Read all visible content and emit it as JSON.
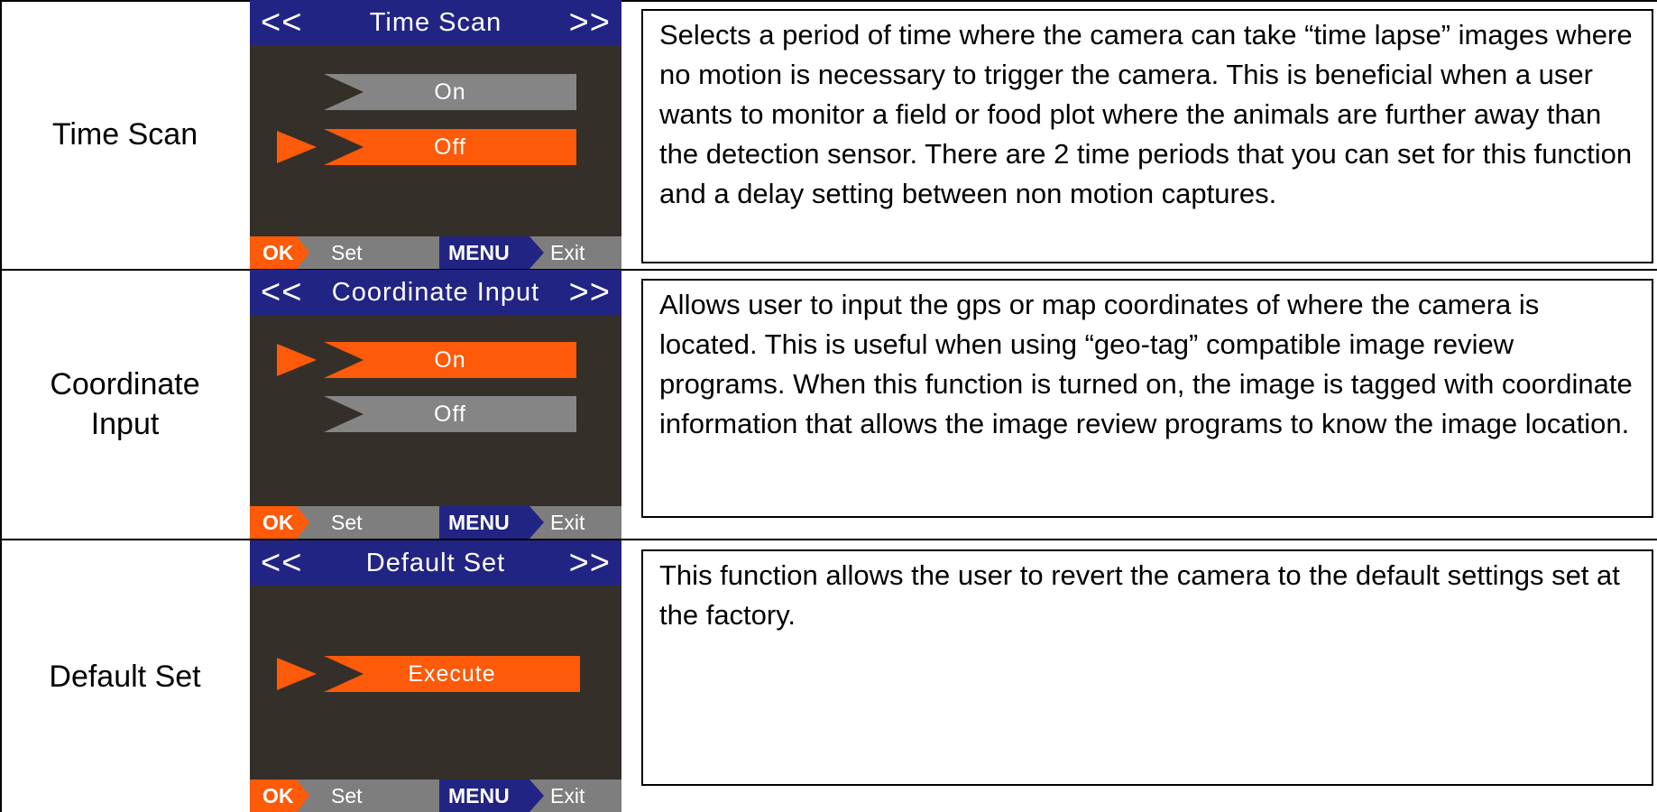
{
  "rows": [
    {
      "label": "Time Scan",
      "screen": {
        "title": "Time Scan",
        "nav_left": "<<",
        "nav_right": ">>",
        "options": [
          "On",
          "Off"
        ],
        "selected_index": 1,
        "footer": {
          "ok": "OK",
          "set": "Set",
          "menu": "MENU",
          "exit": "Exit"
        }
      },
      "description": "Selects a period of time where the camera can take “time lapse” images where no motion is necessary to trigger the camera.  This is beneficial when a user wants to monitor a field or food plot where the animals are further away than the detection sensor.  There are 2 time periods that you can set for this function and a delay setting between non motion captures."
    },
    {
      "label": "Coordinate Input",
      "screen": {
        "title": "Coordinate Input",
        "nav_left": "<<",
        "nav_right": ">>",
        "options": [
          "On",
          "Off"
        ],
        "selected_index": 0,
        "footer": {
          "ok": "OK",
          "set": "Set",
          "menu": "MENU",
          "exit": "Exit"
        }
      },
      "description": "Allows user to input the gps or map coordinates of where the camera is located.  This is useful when using “geo-tag” compatible image review programs.  When this function is turned on, the image is tagged with coordinate information that allows the image review programs to know the image location."
    },
    {
      "label": "Default Set",
      "screen": {
        "title": "Default Set",
        "nav_left": "<<",
        "nav_right": ">>",
        "options": [
          "Execute"
        ],
        "selected_index": 0,
        "footer": {
          "ok": "OK",
          "set": "Set",
          "menu": "MENU",
          "exit": "Exit"
        }
      },
      "description": "This function allows the user to revert the camera to the default settings set at the factory."
    }
  ],
  "colors": {
    "screen_bg": "#352f29",
    "title_bar": "#222484",
    "selected": "#fd5a0a",
    "unselected": "#858585",
    "footer": "#7e7e7e"
  }
}
